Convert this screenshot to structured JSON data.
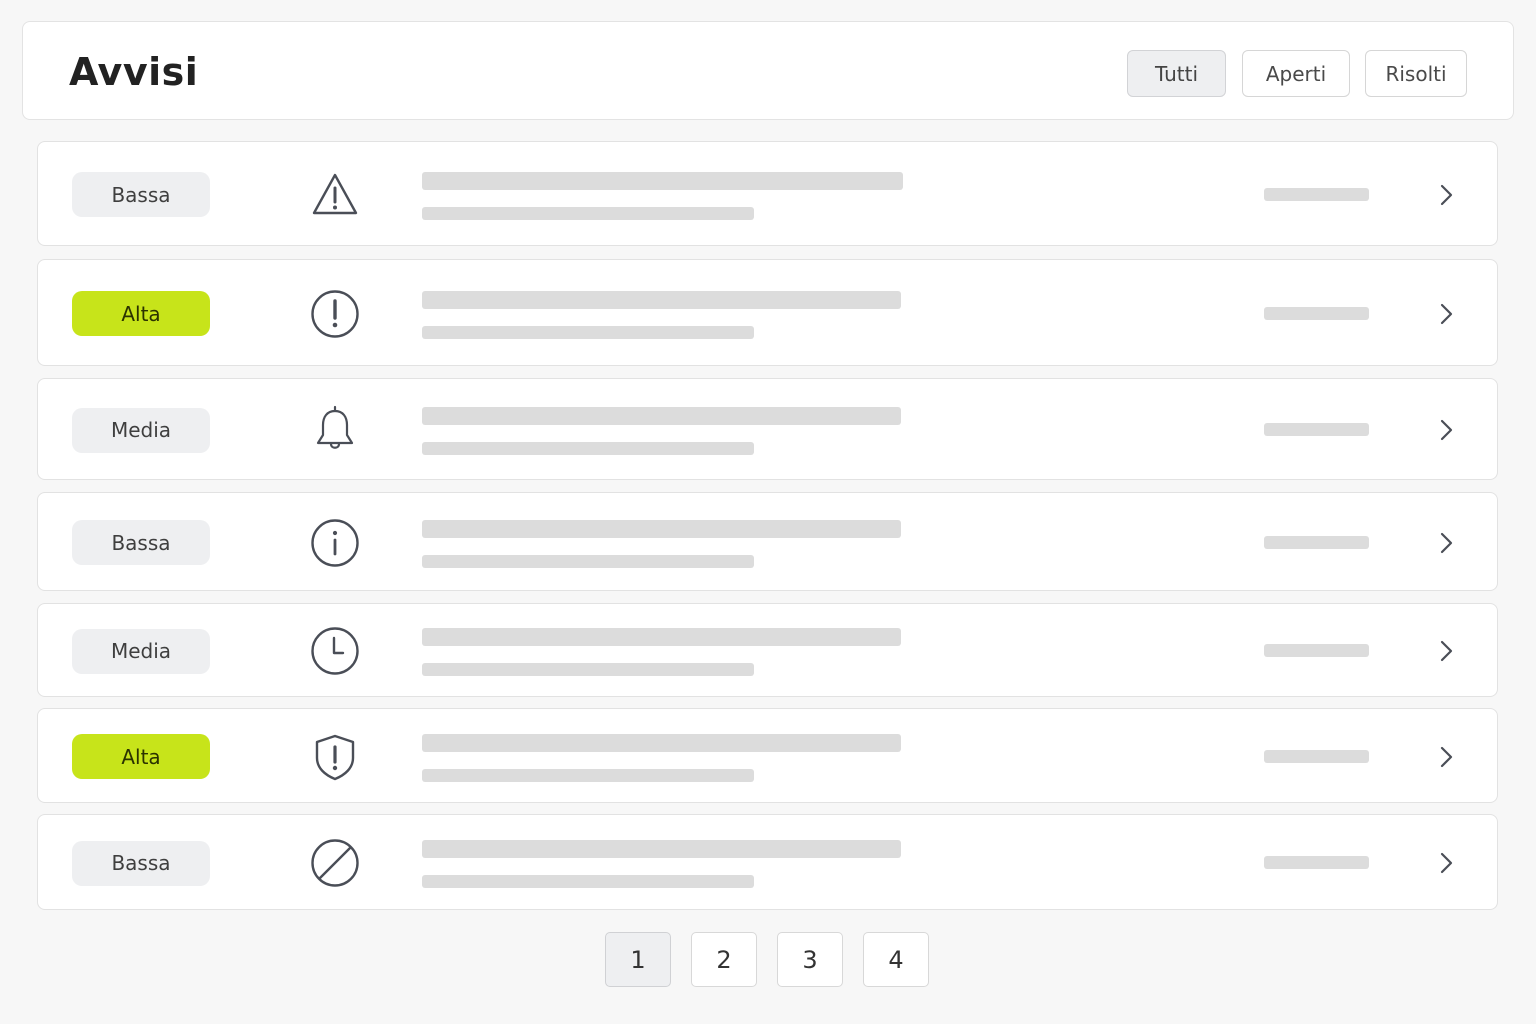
{
  "header": {
    "title": "Avvisi",
    "filters": [
      {
        "label": "Tutti",
        "active": true
      },
      {
        "label": "Aperti",
        "active": false
      },
      {
        "label": "Risolti",
        "active": false
      }
    ]
  },
  "alerts": [
    {
      "priority": "Bassa",
      "level": "low",
      "icon": "warning-triangle-icon"
    },
    {
      "priority": "Alta",
      "level": "high",
      "icon": "exclamation-circle-icon"
    },
    {
      "priority": "Media",
      "level": "medium",
      "icon": "bell-icon"
    },
    {
      "priority": "Bassa",
      "level": "low",
      "icon": "info-circle-icon"
    },
    {
      "priority": "Media",
      "level": "medium",
      "icon": "clock-icon"
    },
    {
      "priority": "Alta",
      "level": "high",
      "icon": "shield-alert-icon"
    },
    {
      "priority": "Bassa",
      "level": "low",
      "icon": "blocked-icon"
    }
  ],
  "pagination": {
    "pages": [
      "1",
      "2",
      "3",
      "4"
    ],
    "current": "1"
  },
  "colors": {
    "accent_high": "#c7e41a",
    "badge_neutral": "#eeeff1",
    "skeleton": "#dcdcdc",
    "icon_stroke": "#4a4e57"
  }
}
